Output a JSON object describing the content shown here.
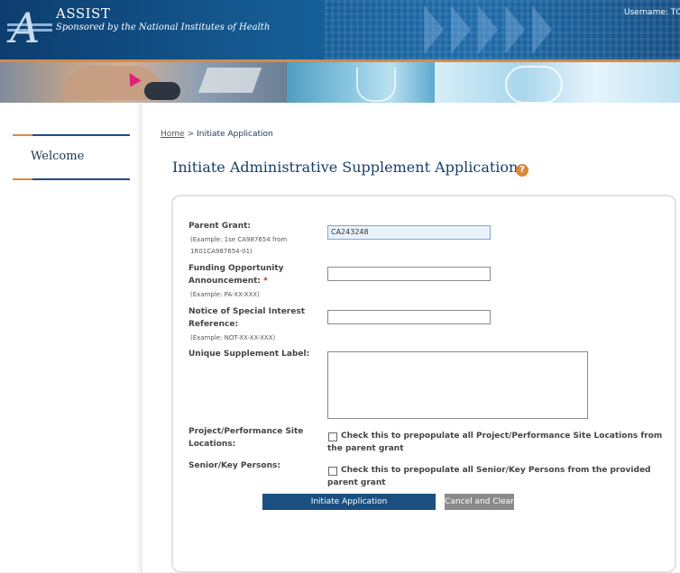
{
  "header": {
    "app_name": "ASSIST",
    "tagline": "Sponsored by the National Institutes of Health",
    "username_label": "Username: TO",
    "logo_letter": "A"
  },
  "sidebar": {
    "items": [
      {
        "label": "Welcome"
      }
    ]
  },
  "breadcrumb": {
    "home": "Home",
    "separator": ">",
    "current": "Initiate Application"
  },
  "page": {
    "title": "Initiate Administrative Supplement Application",
    "help_icon": "question-icon"
  },
  "form": {
    "parent_grant": {
      "label": "Parent Grant",
      "suffix": ":",
      "example_line1": "(Example: 1se CA987654 from",
      "example_line2": "1R01CA987654-01)",
      "value": "CA243248"
    },
    "foa": {
      "label_line1": "Funding Opportunity",
      "label_line2": "Announcement",
      "suffix": ":",
      "required_mark": "*",
      "example": "(Example: PA-XX-XXX)",
      "value": ""
    },
    "nosi": {
      "label_line1": "Notice of Special Interest",
      "label_line2": "Reference",
      "suffix": ":",
      "example": "(Example: NOT-XX-XX-XXX)",
      "value": ""
    },
    "supplement_label": {
      "label": "Unique Supplement Label:",
      "value": ""
    },
    "project_sites": {
      "label_line1": "Project/Performance Site",
      "label_line2": "Locations:",
      "checkbox_line1": "Check this to prepopulate all Project/Performance Site Locations from",
      "checkbox_line2": "the parent grant",
      "checked": false
    },
    "senior_key": {
      "label": "Senior/Key Persons:",
      "checkbox_line1": "Check this to prepopulate all Senior/Key Persons from the provided",
      "checkbox_line2": "parent grant",
      "checked": false
    }
  },
  "buttons": {
    "initiate": "Initiate Application",
    "cancel": "Cancel and Clear"
  },
  "colors": {
    "header_blue": "#155b93",
    "accent_orange": "#d98a43",
    "title_blue": "#17406b",
    "primary_button": "#1b4f80",
    "secondary_button": "#8a8a8a"
  }
}
